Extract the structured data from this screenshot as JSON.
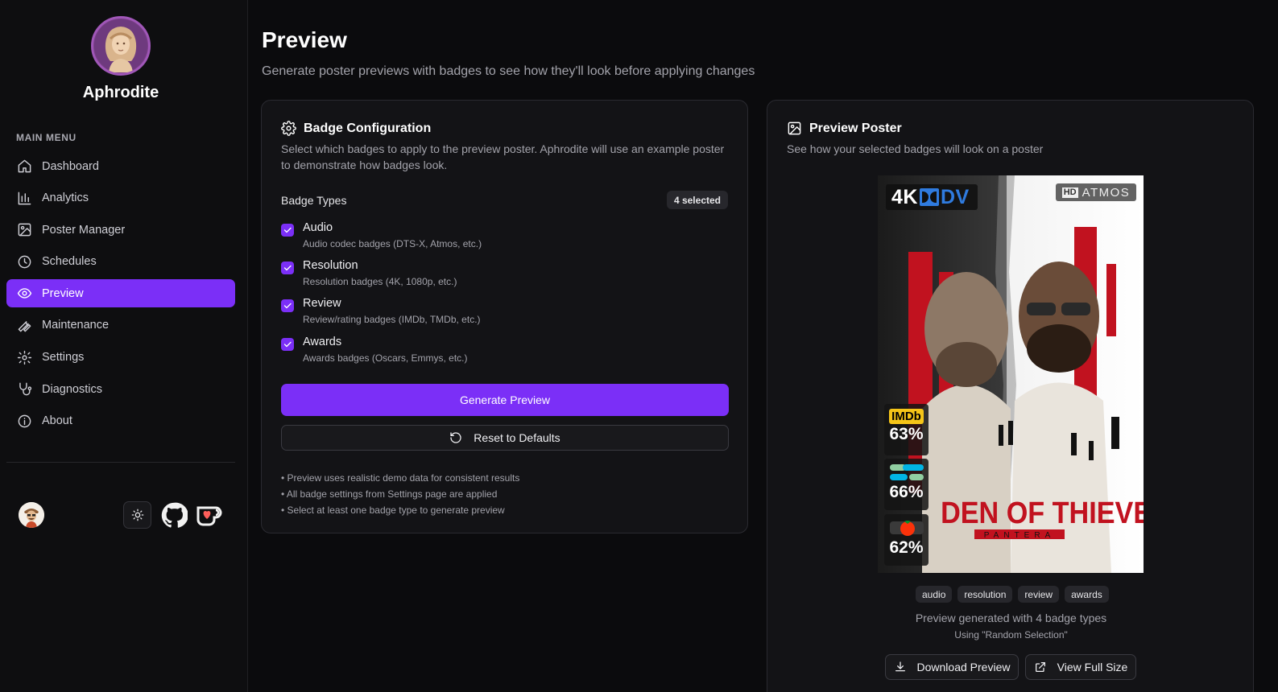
{
  "brand": {
    "name": "Aphrodite"
  },
  "sidebar": {
    "section_label": "MAIN MENU",
    "items": [
      {
        "label": "Dashboard",
        "icon": "home-icon"
      },
      {
        "label": "Analytics",
        "icon": "bar-chart-icon"
      },
      {
        "label": "Poster Manager",
        "icon": "image-icon"
      },
      {
        "label": "Schedules",
        "icon": "clock-icon"
      },
      {
        "label": "Preview",
        "icon": "eye-icon",
        "active": true
      },
      {
        "label": "Maintenance",
        "icon": "wrench-icon"
      },
      {
        "label": "Settings",
        "icon": "gear-icon"
      },
      {
        "label": "Diagnostics",
        "icon": "stethoscope-icon"
      },
      {
        "label": "About",
        "icon": "info-icon"
      }
    ]
  },
  "page": {
    "title": "Preview",
    "subtitle": "Generate poster previews with badges to see how they'll look before applying changes"
  },
  "config": {
    "title": "Badge Configuration",
    "description": "Select which badges to apply to the preview poster. Aphrodite will use an example poster to demonstrate how badges look.",
    "badge_types_label": "Badge Types",
    "selected_count": "4 selected",
    "options": [
      {
        "title": "Audio",
        "subtitle": "Audio codec badges (DTS-X, Atmos, etc.)",
        "checked": true
      },
      {
        "title": "Resolution",
        "subtitle": "Resolution badges (4K, 1080p, etc.)",
        "checked": true
      },
      {
        "title": "Review",
        "subtitle": "Review/rating badges (IMDb, TMDb, etc.)",
        "checked": true
      },
      {
        "title": "Awards",
        "subtitle": "Awards badges (Oscars, Emmys, etc.)",
        "checked": true
      }
    ],
    "generate_label": "Generate Preview",
    "reset_label": "Reset to Defaults",
    "notes": [
      "• Preview uses realistic demo data for consistent results",
      "• All badge settings from Settings page are applied",
      "• Select at least one badge type to generate preview"
    ]
  },
  "preview": {
    "title": "Preview Poster",
    "description": "See how your selected badges will look on a poster",
    "poster": {
      "resolution_badge": "4K",
      "resolution_badge_suffix": "DV",
      "audio_badge_prefix": "HD",
      "audio_badge": "ATMOS",
      "imdb_label": "IMDb",
      "imdb_score": "63%",
      "tmdb_score": "66%",
      "rt_score": "62%",
      "movie_title": "DEN OF THIEVES",
      "movie_subtitle": "PANTERA"
    },
    "tags": [
      "audio",
      "resolution",
      "review",
      "awards"
    ],
    "generated_text": "Preview generated with 4 badge types",
    "using_text": "Using \"Random Selection\"",
    "download_label": "Download Preview",
    "fullsize_label": "View Full Size"
  },
  "colors": {
    "accent": "#7b2ff7",
    "background": "#0b0b0d",
    "card": "#131316"
  }
}
